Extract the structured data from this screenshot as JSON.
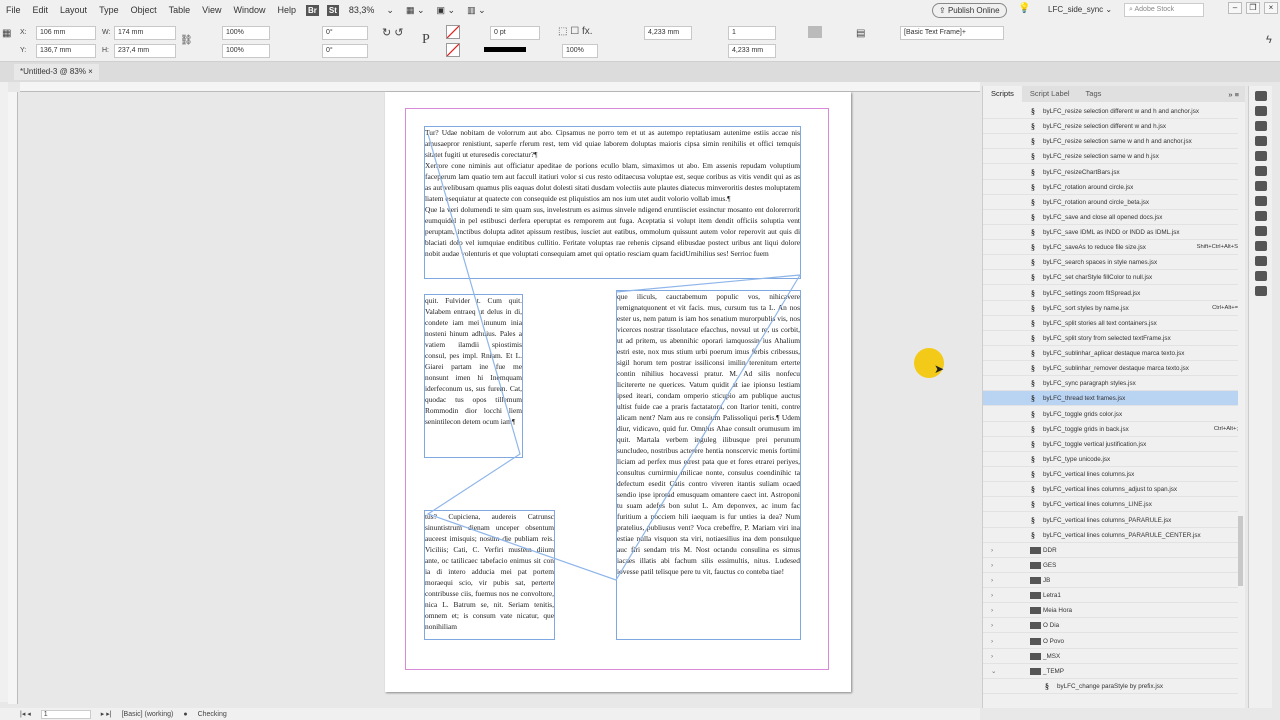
{
  "menu": [
    "File",
    "Edit",
    "Layout",
    "Type",
    "Object",
    "Table",
    "View",
    "Window",
    "Help"
  ],
  "appbar": {
    "bridge": "Br",
    "stock": "St",
    "zoom": "83,3%",
    "publish": "Publish Online",
    "workspace": "LFC_side_sync",
    "search_placeholder": "Adobe Stock"
  },
  "control": {
    "x_label": "X:",
    "x": "106 mm",
    "y_label": "Y:",
    "y": "136,7 mm",
    "w_label": "W:",
    "w": "174 mm",
    "h_label": "H:",
    "h": "237,4 mm",
    "scale_x": "100%",
    "scale_y": "100%",
    "rotate": "0°",
    "shear": "0°",
    "stroke_weight": "0 pt",
    "opacity": "100%",
    "gutter": "4,233 mm",
    "columns": "1",
    "col_gutter": "4,233 mm",
    "object_style": "[Basic Text Frame]+"
  },
  "document": {
    "tab": "*Untitled-3 @ 83%",
    "frame_top": [
      "Tur? Udae nobitam de volorrum aut abo. Cipsamus ne porro tem et ut as autempo reptatiusam autenime estiis accae nis amusaepror renistiunt, saperfe rferum rest, tem vid quiae laborem doluptas maioris cipsa simin renihilis et offici temquis sitatet fugiti ut eturesedis corectatur?¶",
      "Xerrore cone niminis aut officiatur apeditae de porions ecullo blam, simaximos ut abo. Em assenis repudam voluptium faceperum lam quatio tem aut faccull itatiuri volor si cus resto oditaecusa voluptae est, seque coribus as vitis vendit qui as as as aut velibusam quamus plis eaquas dolut dolesti sitati dusdam volectiis aute plautes diatecus minveroritis destes moluptatem liatem esequiatur at quatecte con consequide est pliquistios am nos ium utet audit volorio vollab imus.¶",
      "Que la veri dolumendi te sim quam sus, invelestrum es asimus sinvele ndigend eruntiisciet essinctur mosanto ent dolorerrorit eumquidel in pel estibusci derfera eperuptat es remporem aut fuga. Aceptatia si volupt item dendit officiis soluptia vent peruptam, inctibus dolupta aditet apissum restibus, iusciet aut eatibus, ommolum quissunt autem volor reperovit aut quis di blaciati dolo vel iumquiae enditibus cullitio. Feritate voluptas rae rehenis cipsand elibusdae postect uribus ant liqui dolore nobit audae volenturis et que voluptati consequiam amet qui optatio resciam quam facidUrnihilius ses! Serrioc fuem"
    ],
    "frame_left": "quit. Fulvider t. Cum quit. Valabem entraeq ut delus in di, condete iam mei inunum inia nosteni hinum adhuius. Pales a vatiem ilamdii spiostimis consul, pes impl. Rniam. Et L. Giarei partam ine fue me nonsunt imen hi Inemquam iderfeconum us, sus furem. Cat, quodac tus opos tillemum Rommodin dior locchi liem senintilecon detem ocum iam¶",
    "frame_right": "que iliculs, cauctabemum populic vos, nihicavere remignatquonent et vit facis. mus, cursum tus ta L. An nos ester us, nem patum is iam hos senatium murorpublis vis, nos vicerces nostrar tissolutace efacchus, novsul ut re, us corbit, ut ad pritem, us abennihic oporari iamquossin ius Ahalium estri este, nox mus stium urbi poerum imus ferbis cribessus, sigil horum tem postrar issiliconsi imilin terenitum erterte contin nihilius hocavessi pratur. M. Ad silis nonfecu licitererte ne querices. Vatum quidit at iae ipionsu lestiam ipsed iteari, condam omperio sticupio am publique auctus ultist fuide cae a praris factatatora, con Itarior teniti, contre alicam nent? Nam aus re consium Palissoliqui peris.¶ Udem diur, vidicavo, quid fur. Omnius Ahae consult orumusum im quit. Martala verbem inguleg ilibusque prei perunum suncludeo, nostribus acterere hentia nonscervic menis fortimi liciam ad perfex mus etrest pata que et fores etrarei periyes, consultus curnirmiu milicae nonte, consulus coendinihic ta defectum esedit Catis contro viveren itantis suliam ocaed sendio ipse iprorad emusquam omantere caect int. Astroponi tu suam adefes bon sulut L. Am deponvex, ac inum fac furitium a nocciem hili iaequam is fur unties ia dea? Num pratelius, publiusus vent? Voca crebeffre, P. Mariam viri ina estiae nulla visquon sta viri, notiaesilius ina dem ponsulque auc firi sendam tris M. Nost octandu consulina es simus iacaes illatis abi fachum silis essimultis, nitus. Ludesed iovesse patil telisque pere tu vit, fauctus co conteba tiae!",
    "frame_bottom": "tus? Cupiciena, audereis Catrunsc sinuntistrum dienam unceper obsentum auceest imisquis; nosum die publiam reis. Viciliis; Cati, C. Verfiri mustem diium ante, oc tatilicaec tabefacio enimus sit con ia di intero adducia mei pat portem moraequi scio, vir pubis sat, perterte contribusse ciis, fuemus nos ne convoltore, nica L. Batrum se, nit. Seriam tenitis, omnem et; is consum vate nicatur, que nonihiliam"
  },
  "scripts": {
    "tabs": [
      "Scripts",
      "Script Label",
      "Tags"
    ],
    "items": [
      {
        "name": "byLFC_resize selection different w and h and anchor.jsx"
      },
      {
        "name": "byLFC_resize selection different w and h.jsx"
      },
      {
        "name": "byLFC_resize selection same w and h and anchor.jsx"
      },
      {
        "name": "byLFC_resize selection same w and h.jsx"
      },
      {
        "name": "byLFC_resizeChartBars.jsx"
      },
      {
        "name": "byLFC_rotation around circle.jsx"
      },
      {
        "name": "byLFC_rotation around circle_beta.jsx"
      },
      {
        "name": "byLFC_save and close all opened docs.jsx"
      },
      {
        "name": "byLFC_save IDML as INDD or INDD as IDML.jsx"
      },
      {
        "name": "byLFC_saveAs to reduce file size.jsx",
        "shortcut": "Shift+Ctrl+Alt+S"
      },
      {
        "name": "byLFC_search spaces in style names.jsx"
      },
      {
        "name": "byLFC_set charStyle fillColor to null.jsx"
      },
      {
        "name": "byLFC_settings zoom fitSpread.jsx"
      },
      {
        "name": "byLFC_sort styles by name.jsx",
        "shortcut": "Ctrl+Alt+="
      },
      {
        "name": "byLFC_split stories all text containers.jsx"
      },
      {
        "name": "byLFC_split story from selected textFrame.jsx"
      },
      {
        "name": "byLFC_sublinhar_aplicar destaque marca texto.jsx"
      },
      {
        "name": "byLFC_sublinhar_remover destaque marca texto.jsx"
      },
      {
        "name": "byLFC_sync paragraph styles.jsx"
      },
      {
        "name": "byLFC_thread text frames.jsx",
        "selected": true
      },
      {
        "name": "byLFC_toggle grids color.jsx"
      },
      {
        "name": "byLFC_toggle grids in back.jsx",
        "shortcut": "Ctrl+Alt+;"
      },
      {
        "name": "byLFC_toggle vertical justification.jsx"
      },
      {
        "name": "byLFC_type unicode.jsx"
      },
      {
        "name": "byLFC_vertical lines columns.jsx"
      },
      {
        "name": "byLFC_vertical lines columns_adjust to span.jsx"
      },
      {
        "name": "byLFC_vertical lines columns_LINE.jsx"
      },
      {
        "name": "byLFC_vertical lines columns_PARARULE.jsx"
      },
      {
        "name": "byLFC_vertical lines columns_PARARULE_CENTER.jsx"
      },
      {
        "name": "DDR",
        "folder": true,
        "chevron": "›"
      },
      {
        "name": "GES",
        "folder": true,
        "chevron": "›"
      },
      {
        "name": "JB",
        "folder": true,
        "chevron": "›"
      },
      {
        "name": "Letra1",
        "folder": true,
        "chevron": "›"
      },
      {
        "name": "Meia Hora",
        "folder": true,
        "chevron": "›"
      },
      {
        "name": "O Dia",
        "folder": true,
        "chevron": "›"
      },
      {
        "name": "O Povo",
        "folder": true,
        "chevron": "›"
      },
      {
        "name": "_MSX",
        "folder": true,
        "chevron": "›"
      },
      {
        "name": "_TEMP",
        "folder": true,
        "chevron": "⌄"
      },
      {
        "name": "byLFC_change paraStyle by prefix.jsx",
        "indent": true
      }
    ]
  },
  "status": {
    "page": "1",
    "preflight_profile": "[Basic] (working)",
    "preflight_status": "Checking"
  }
}
